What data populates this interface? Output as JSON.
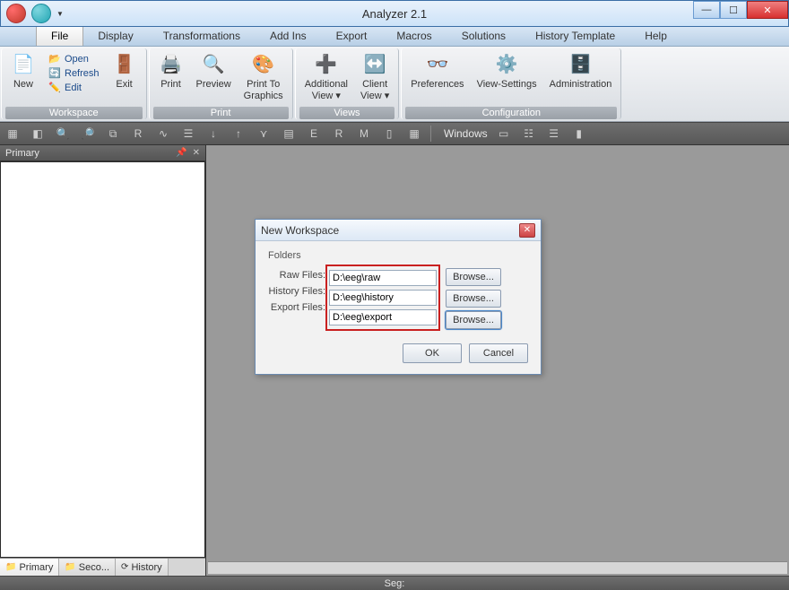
{
  "app": {
    "title": "Analyzer 2.1"
  },
  "menus": {
    "file": "File",
    "display": "Display",
    "transformations": "Transformations",
    "addins": "Add Ins",
    "export": "Export",
    "macros": "Macros",
    "solutions": "Solutions",
    "history_template": "History Template",
    "help": "Help"
  },
  "ribbon": {
    "workspace": {
      "label": "Workspace",
      "new": "New",
      "open": "Open",
      "refresh": "Refresh",
      "edit": "Edit",
      "exit": "Exit"
    },
    "print": {
      "label": "Print",
      "print": "Print",
      "preview": "Preview",
      "print_to_graphics": "Print To\nGraphics"
    },
    "views": {
      "label": "Views",
      "additional_view": "Additional\nView ▾",
      "client_view": "Client\nView ▾"
    },
    "configuration": {
      "label": "Configuration",
      "preferences": "Preferences",
      "view_settings": "View-Settings",
      "administration": "Administration"
    }
  },
  "toolbar": {
    "windows_label": "Windows"
  },
  "side": {
    "title": "Primary",
    "tabs": {
      "primary": "Primary",
      "secondary": "Seco...",
      "history": "History"
    }
  },
  "dialog": {
    "title": "New Workspace",
    "folders_label": "Folders",
    "rows": {
      "raw": {
        "label": "Raw Files:",
        "value": "D:\\eeg\\raw",
        "browse": "Browse..."
      },
      "history": {
        "label": "History Files:",
        "value": "D:\\eeg\\history",
        "browse": "Browse..."
      },
      "export": {
        "label": "Export Files:",
        "value": "D:\\eeg\\export",
        "browse": "Browse..."
      }
    },
    "ok": "OK",
    "cancel": "Cancel"
  },
  "status": {
    "seg": "Seg:"
  }
}
